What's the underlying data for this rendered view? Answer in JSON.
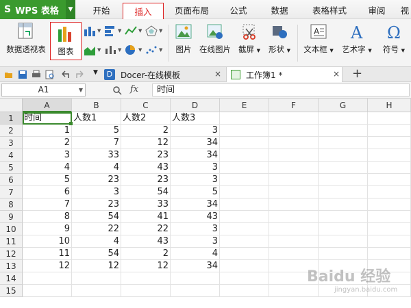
{
  "app": {
    "logo": "S",
    "title": "WPS 表格"
  },
  "menu": [
    "开始",
    "插入",
    "页面布局",
    "公式",
    "数据",
    "表格样式",
    "审阅",
    "视"
  ],
  "menu_active": "插入",
  "ribbon": {
    "pivot_label": "数据透视表",
    "chart_label": "图表",
    "picture_label": "图片",
    "online_picture_label": "在线图片",
    "screenshot_label": "截屏",
    "shapes_label": "形状",
    "textbox_label": "文本框",
    "wordart_label": "艺术字",
    "symbol_label": "符号"
  },
  "tabs": [
    {
      "label": "Docer-在线模板"
    },
    {
      "label": "工作簿1 *"
    }
  ],
  "tab_close": "×",
  "new_tab": "+",
  "formula": {
    "cell": "A1",
    "fx": "fx",
    "content": "时间"
  },
  "columns": [
    "A",
    "B",
    "C",
    "D",
    "E",
    "F",
    "G",
    "H"
  ],
  "rows": [
    "1",
    "2",
    "3",
    "4",
    "5",
    "6",
    "7",
    "8",
    "9",
    "10",
    "11",
    "12",
    "13",
    "14",
    "15"
  ],
  "table": {
    "header": [
      "时间",
      "人数1",
      "人数2",
      "人数3"
    ],
    "rows": [
      [
        "1",
        "5",
        "2",
        "3"
      ],
      [
        "2",
        "7",
        "12",
        "34"
      ],
      [
        "3",
        "33",
        "23",
        "34"
      ],
      [
        "4",
        "4",
        "43",
        "3"
      ],
      [
        "5",
        "23",
        "23",
        "3"
      ],
      [
        "6",
        "3",
        "54",
        "5"
      ],
      [
        "7",
        "23",
        "33",
        "34"
      ],
      [
        "8",
        "54",
        "41",
        "43"
      ],
      [
        "9",
        "22",
        "22",
        "3"
      ],
      [
        "10",
        "4",
        "43",
        "3"
      ],
      [
        "11",
        "54",
        "2",
        "4"
      ],
      [
        "12",
        "12",
        "12",
        "34"
      ]
    ]
  },
  "colors": {
    "brand": "#3a9a2e",
    "active_tab": "#dd2222",
    "selection": "#3b8a2e"
  }
}
